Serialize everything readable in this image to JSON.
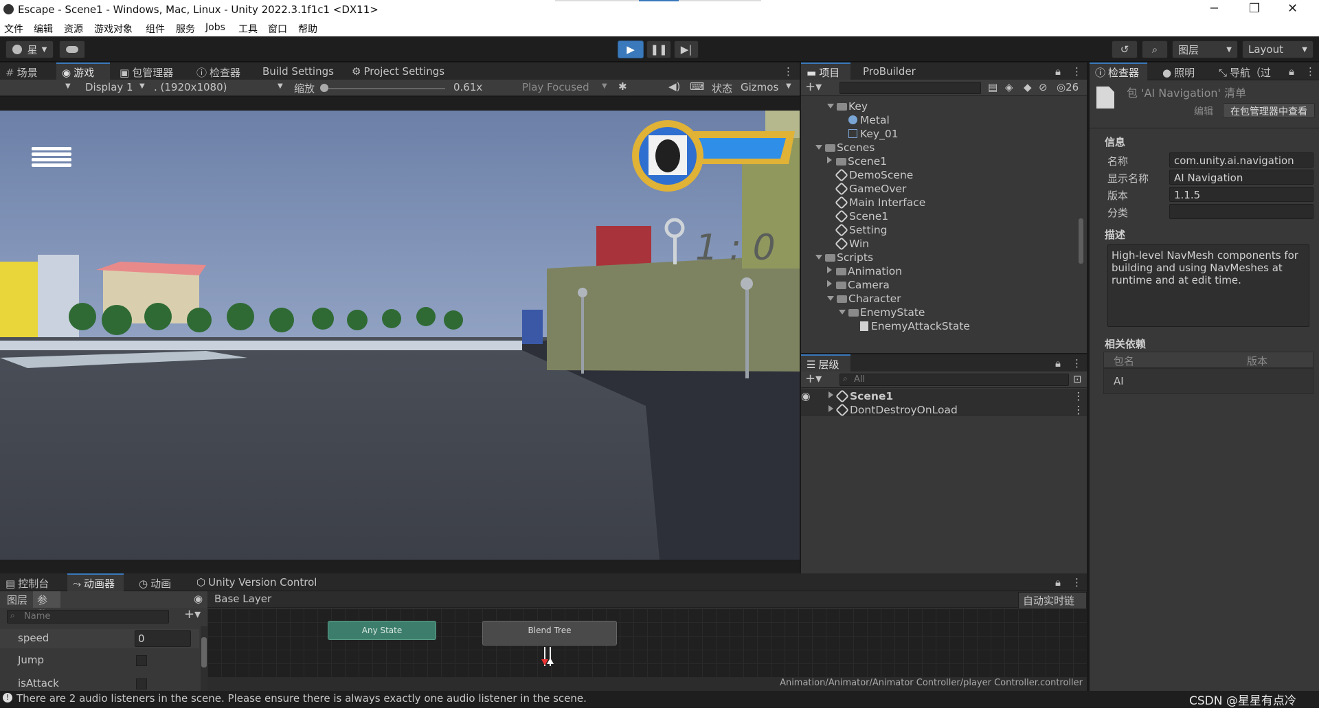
{
  "titlebar": {
    "title": "Escape - Scene1 - Windows, Mac, Linux - Unity 2022.3.1f1c1 <DX11>",
    "minimize": "─",
    "maximize": "❐",
    "close": "✕"
  },
  "menubar": [
    "文件",
    "编辑",
    "资源",
    "游戏对象",
    "组件",
    "服务",
    "Jobs",
    "工具",
    "窗口",
    "帮助"
  ],
  "toolbar": {
    "account_label": "星",
    "layers_label": "图层",
    "layout_label": "Layout"
  },
  "game_view": {
    "tabs": [
      "场景",
      "游戏",
      "包管理器",
      "检查器",
      "Build Settings",
      "Project Settings"
    ],
    "display": "Display 1",
    "resolution": ". (1920x1080)",
    "scale_label": "缩放",
    "scale_value": "0.61x",
    "play_focused": "Play Focused",
    "stats_label": "状态",
    "gizmos_label": "Gizmos",
    "hud_key_count": "1 : 0"
  },
  "project_panel": {
    "tabs": [
      "项目",
      "ProBuilder"
    ],
    "hidden_count": "26",
    "tree": [
      {
        "label": "Key",
        "depth": 2,
        "kind": "folder",
        "expanded": true
      },
      {
        "label": "Metal",
        "depth": 3,
        "kind": "material"
      },
      {
        "label": "Key_01",
        "depth": 3,
        "kind": "mesh"
      },
      {
        "label": "Scenes",
        "depth": 1,
        "kind": "folder",
        "expanded": true
      },
      {
        "label": "Scene1",
        "depth": 2,
        "kind": "folder",
        "expanded": false
      },
      {
        "label": "DemoScene",
        "depth": 2,
        "kind": "scene"
      },
      {
        "label": "GameOver",
        "depth": 2,
        "kind": "scene"
      },
      {
        "label": "Main Interface",
        "depth": 2,
        "kind": "scene"
      },
      {
        "label": "Scene1",
        "depth": 2,
        "kind": "scene"
      },
      {
        "label": "Setting",
        "depth": 2,
        "kind": "scene"
      },
      {
        "label": "Win",
        "depth": 2,
        "kind": "scene"
      },
      {
        "label": "Scripts",
        "depth": 1,
        "kind": "folder",
        "expanded": true
      },
      {
        "label": "Animation",
        "depth": 2,
        "kind": "folder",
        "expanded": false
      },
      {
        "label": "Camera",
        "depth": 2,
        "kind": "folder",
        "expanded": false
      },
      {
        "label": "Character",
        "depth": 2,
        "kind": "folder",
        "expanded": true
      },
      {
        "label": "EnemyState",
        "depth": 3,
        "kind": "folder",
        "expanded": true
      },
      {
        "label": "EnemyAttackState",
        "depth": 4,
        "kind": "script"
      }
    ]
  },
  "hierarchy_panel": {
    "tab": "层级",
    "search_placeholder": "All",
    "items": [
      "Scene1",
      "DontDestroyOnLoad"
    ]
  },
  "inspector": {
    "tabs": [
      "检查器",
      "照明",
      "导航（过"
    ],
    "header_title": "包 'AI Navigation' 清单",
    "edit_button": "编辑",
    "view_in_pm_button": "在包管理器中查看",
    "info_heading": "信息",
    "fields": [
      {
        "label": "名称",
        "value": "com.unity.ai.navigation"
      },
      {
        "label": "显示名称",
        "value": "AI Navigation"
      },
      {
        "label": "版本",
        "value": "1.1.5"
      },
      {
        "label": "分类",
        "value": ""
      }
    ],
    "desc_heading": "描述",
    "description": "High-level NavMesh components for building and using NavMeshes at runtime and at edit time.",
    "deps_heading": "相关依赖",
    "deps_col_name": "包名",
    "deps_col_version": "版本",
    "deps_rows": [
      {
        "name": "AI",
        "version": ""
      }
    ]
  },
  "bottom_panel": {
    "tabs": [
      "控制台",
      "动画器",
      "动画",
      "Unity Version Control"
    ],
    "sub_tabs": [
      "图层",
      "参数"
    ],
    "search_placeholder": "Name",
    "params": [
      {
        "name": "speed",
        "value": "0",
        "type": "float"
      },
      {
        "name": "Jump",
        "type": "bool"
      },
      {
        "name": "isAttack",
        "type": "bool"
      }
    ],
    "breadcrumb": "Base Layer",
    "auto_live_link": "自动实时链接",
    "nodes": [
      "Any State",
      "Blend Tree"
    ],
    "controller_path": "Animation/Animator/Animator Controller/player Controller.controller"
  },
  "statusbar": {
    "message": "There are 2 audio listeners in the scene. Please ensure there is always exactly one audio listener in the scene.",
    "watermark": "CSDN @星星有点冷"
  },
  "colors": {
    "editor_bg": "#383838",
    "play_active": "#3a79bb",
    "any_state": "#3d7d6c",
    "blend_tree": "#4a4a4a"
  }
}
